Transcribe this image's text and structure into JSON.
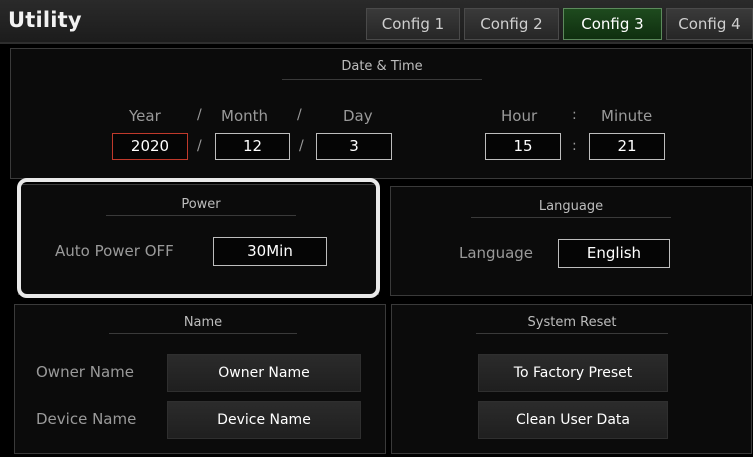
{
  "app": {
    "title": "Utility"
  },
  "tabs": [
    {
      "label": "Config 1"
    },
    {
      "label": "Config 2"
    },
    {
      "label": "Config 3",
      "active": true
    },
    {
      "label": "Config 4"
    }
  ],
  "date_time": {
    "title": "Date & Time",
    "labels": {
      "year": "Year",
      "month": "Month",
      "day": "Day",
      "hour": "Hour",
      "minute": "Minute"
    },
    "values": {
      "year": "2020",
      "month": "12",
      "day": "3",
      "hour": "15",
      "minute": "21"
    },
    "date_separator": "/",
    "time_separator": ":"
  },
  "power": {
    "title": "Power",
    "auto_power_off_label": "Auto Power OFF",
    "auto_power_off_value": "30Min"
  },
  "language": {
    "title": "Language",
    "label": "Language",
    "value": "English"
  },
  "name": {
    "title": "Name",
    "owner_label": "Owner Name",
    "owner_button": "Owner Name",
    "device_label": "Device Name",
    "device_button": "Device Name"
  },
  "system_reset": {
    "title": "System Reset",
    "factory_button": "To Factory Preset",
    "clean_button": "Clean User Data"
  },
  "colors": {
    "active_tab": "#1e4a1e",
    "selected_field_border": "#c0392b",
    "focus_ring": "#e9e9e9"
  }
}
